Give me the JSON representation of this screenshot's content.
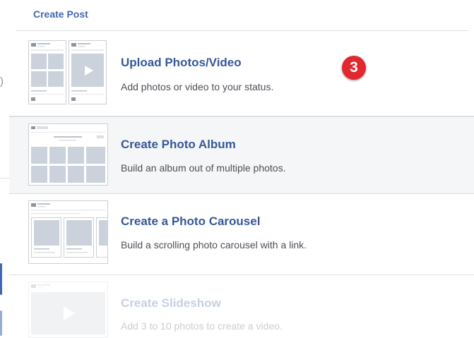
{
  "header": {
    "title": "Create Post"
  },
  "options": [
    {
      "title": "Upload Photos/Video",
      "desc": "Add photos or video to your status.",
      "icon": "upload-photos-video-icon"
    },
    {
      "title": "Create Photo Album",
      "desc": "Build an album out of multiple photos.",
      "icon": "photo-album-icon"
    },
    {
      "title": "Create a Photo Carousel",
      "desc": "Build a scrolling photo carousel with a link.",
      "icon": "photo-carousel-icon"
    },
    {
      "title": "Create Slideshow",
      "desc": "Add 3 to 10 photos to create a video.",
      "icon": "slideshow-icon"
    }
  ],
  "step_badge": "3",
  "left_partial_text": ")",
  "colors": {
    "accent": "#4267b2",
    "title": "#365899",
    "badge": "#e0282e",
    "hover_row": "#f5f6f7"
  }
}
